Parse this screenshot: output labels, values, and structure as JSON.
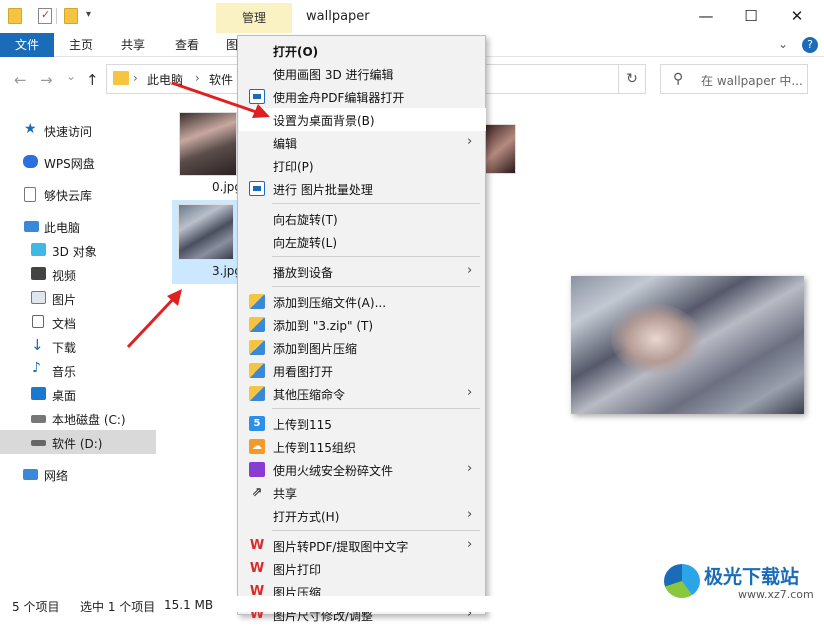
{
  "titlebar": {
    "manage_tab": "管理",
    "title": "wallpaper",
    "minimize": "—",
    "maximize": "☐",
    "close": "✕"
  },
  "ribbon": {
    "tabs": [
      "文件",
      "主页",
      "共享",
      "查看",
      "图"
    ],
    "expand_icon": "chevron-down-icon",
    "help": "?"
  },
  "nav": {
    "back": "←",
    "forward": "→",
    "recent": "⌄",
    "up": "↑",
    "breadcrumbs": [
      "此电脑",
      "软件"
    ],
    "refresh": "↻",
    "search_placeholder": "在 wallpaper 中..."
  },
  "sidebar": {
    "items": [
      {
        "label": "快速访问",
        "icon": "star-icon"
      },
      {
        "label": "WPS网盘",
        "icon": "cloud-icon"
      },
      {
        "label": "够快云库",
        "icon": "document-icon"
      },
      {
        "label": "此电脑",
        "icon": "computer-icon"
      },
      {
        "label": "3D 对象",
        "icon": "cube-icon"
      },
      {
        "label": "视频",
        "icon": "video-icon"
      },
      {
        "label": "图片",
        "icon": "picture-icon"
      },
      {
        "label": "文档",
        "icon": "document-icon"
      },
      {
        "label": "下载",
        "icon": "download-icon"
      },
      {
        "label": "音乐",
        "icon": "music-icon"
      },
      {
        "label": "桌面",
        "icon": "desktop-icon"
      },
      {
        "label": "本地磁盘 (C:)",
        "icon": "drive-icon"
      },
      {
        "label": "软件 (D:)",
        "icon": "drive-icon",
        "selected": true
      },
      {
        "label": "网络",
        "icon": "network-icon"
      }
    ]
  },
  "files": [
    {
      "name": "0.jpg",
      "selected": false
    },
    {
      "name": "3.jpg",
      "selected": true
    }
  ],
  "context_menu": {
    "items": [
      {
        "label": "打开(O)",
        "bold": true
      },
      {
        "label": "使用画图 3D 进行编辑"
      },
      {
        "label": "使用金舟PDF编辑器打开",
        "icon": "pdf-editor-icon"
      },
      {
        "label": "设置为桌面背景(B)",
        "hover": true
      },
      {
        "label": "编辑",
        "submenu": true
      },
      {
        "label": "打印(P)"
      },
      {
        "label": "进行 图片批量处理",
        "icon": "batch-icon"
      },
      {
        "label": "向右旋转(T)"
      },
      {
        "label": "向左旋转(L)"
      },
      {
        "label": "播放到设备",
        "submenu": true
      },
      {
        "label": "添加到压缩文件(A)...",
        "icon": "archive-icon"
      },
      {
        "label": "添加到 \"3.zip\" (T)",
        "icon": "archive-icon"
      },
      {
        "label": "添加到图片压缩",
        "icon": "archive-icon"
      },
      {
        "label": "用看图打开",
        "icon": "archive-icon"
      },
      {
        "label": "其他压缩命令",
        "icon": "archive-icon",
        "submenu": true
      },
      {
        "label": "上传到115",
        "icon": "cloud-115-icon",
        "glyph": "5"
      },
      {
        "label": "上传到115组织",
        "icon": "cloud-115-org-icon",
        "glyph": "☁"
      },
      {
        "label": "使用火绒安全粉碎文件",
        "icon": "shredder-icon",
        "submenu": true
      },
      {
        "label": "共享",
        "icon": "share-icon",
        "glyph": "⇗"
      },
      {
        "label": "打开方式(H)",
        "submenu": true
      },
      {
        "label": "图片转PDF/提取图中文字",
        "icon": "wps-icon",
        "glyph": "W",
        "submenu": true
      },
      {
        "label": "图片打印",
        "icon": "wps-icon",
        "glyph": "W"
      },
      {
        "label": "图片压缩",
        "icon": "wps-icon",
        "glyph": "W"
      },
      {
        "label": "图片尺寸修改/调整",
        "icon": "wps-icon",
        "glyph": "W",
        "submenu": true
      }
    ]
  },
  "status": {
    "count": "5 个项目",
    "selected": "选中 1 个项目",
    "size": "15.1 MB"
  },
  "watermark": {
    "text": "极光下载站",
    "url": "www.xz7.com"
  }
}
